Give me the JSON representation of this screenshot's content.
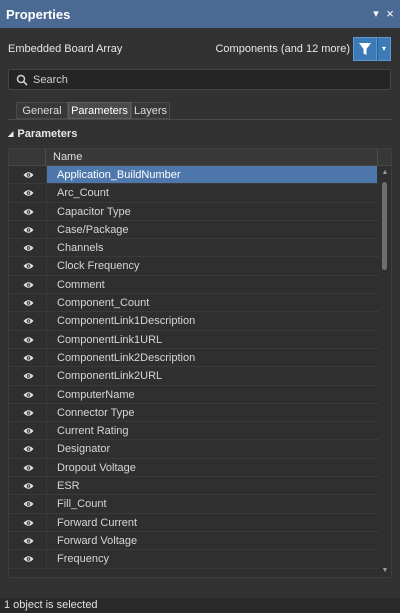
{
  "panel": {
    "title": "Properties",
    "menu_glyph": "▾",
    "close_glyph": "×"
  },
  "header": {
    "object_type": "Embedded Board Array",
    "filter_label": "Components (and 12 more)",
    "filter_icon": "funnel-icon",
    "dropdown_glyph": "▾"
  },
  "search": {
    "placeholder": "Search",
    "value": ""
  },
  "tabs": [
    {
      "label": "General",
      "active": false
    },
    {
      "label": "Parameters",
      "active": true
    },
    {
      "label": "Layers",
      "active": false
    }
  ],
  "section": {
    "title": "Parameters",
    "expanded_glyph": "◢"
  },
  "grid": {
    "columns": [
      "",
      "Name"
    ],
    "rows": [
      {
        "name": "Application_BuildNumber",
        "selected": true
      },
      {
        "name": "Arc_Count",
        "selected": false
      },
      {
        "name": "Capacitor Type",
        "selected": false
      },
      {
        "name": "Case/Package",
        "selected": false
      },
      {
        "name": "Channels",
        "selected": false
      },
      {
        "name": "Clock Frequency",
        "selected": false
      },
      {
        "name": "Comment",
        "selected": false
      },
      {
        "name": "Component_Count",
        "selected": false
      },
      {
        "name": "ComponentLink1Description",
        "selected": false
      },
      {
        "name": "ComponentLink1URL",
        "selected": false
      },
      {
        "name": "ComponentLink2Description",
        "selected": false
      },
      {
        "name": "ComponentLink2URL",
        "selected": false
      },
      {
        "name": "ComputerName",
        "selected": false
      },
      {
        "name": "Connector Type",
        "selected": false
      },
      {
        "name": "Current Rating",
        "selected": false
      },
      {
        "name": "Designator",
        "selected": false
      },
      {
        "name": "Dropout Voltage",
        "selected": false
      },
      {
        "name": "ESR",
        "selected": false
      },
      {
        "name": "Fill_Count",
        "selected": false
      },
      {
        "name": "Forward Current",
        "selected": false
      },
      {
        "name": "Forward Voltage",
        "selected": false
      },
      {
        "name": "Frequency",
        "selected": false
      }
    ],
    "scroll_up_glyph": "▲",
    "scroll_down_glyph": "▼"
  },
  "status": {
    "text": "1 object is selected"
  },
  "colors": {
    "titlebar": "#4a6a94",
    "selection": "#4e78ab",
    "accent_button": "#3d7ab8"
  }
}
